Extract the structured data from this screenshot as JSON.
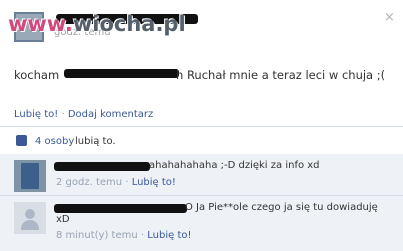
{
  "watermark": {
    "text_left": "www.",
    "text_right": "wiocha.pl"
  },
  "post": {
    "time_text": "godz. temu",
    "content_prefix": "kocham",
    "content_rest": "h Ruchał mnie a teraz leci w chuja ;(",
    "close_icon": "×"
  },
  "actions": {
    "like": "Lubię to!",
    "separator": "·",
    "comment": "Dodaj komentarz"
  },
  "likes": {
    "count": "4 osoby",
    "tail": "lubią to."
  },
  "comments": [
    {
      "text": "ahahahahaha ;-D dzięki za info xd",
      "time": "2 godz. temu",
      "separator": "·",
      "like": "Lubię to!"
    },
    {
      "text_line1": "O Ja Pie**ole czego ja się tu dowiaduję",
      "text_line2": "xD",
      "time": "8 minut(y) temu",
      "separator": "·",
      "like": "Lubię to!"
    }
  ]
}
